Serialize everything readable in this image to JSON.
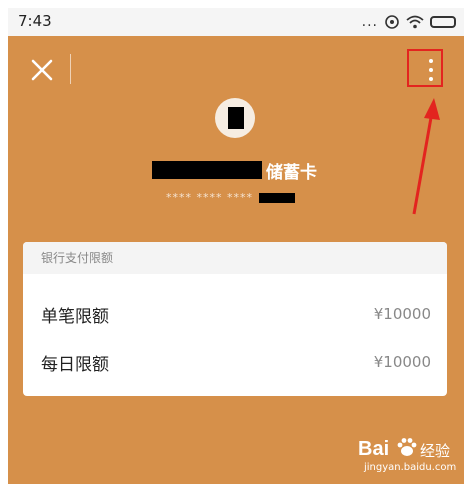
{
  "status_bar": {
    "time": "7:43",
    "dots": "...",
    "icons": [
      "cellular-dots-icon",
      "hotspot-icon",
      "wifi-icon",
      "battery-icon"
    ]
  },
  "header": {
    "close_icon": "close-icon",
    "more_icon": "more-vertical-icon"
  },
  "card": {
    "name_suffix": "储蓄卡",
    "masked_number": "**** **** ****"
  },
  "limits": {
    "title": "银行支付限额",
    "rows": [
      {
        "label": "单笔限额",
        "value": "¥10000"
      },
      {
        "label": "每日限额",
        "value": "¥10000"
      }
    ]
  },
  "watermark": {
    "brand": "Bai",
    "suffix": "经验",
    "url": "jingyan.baidu.com"
  },
  "colors": {
    "background": "#d6904a",
    "highlight": "#e3241f",
    "card_surface": "#ffffff"
  }
}
